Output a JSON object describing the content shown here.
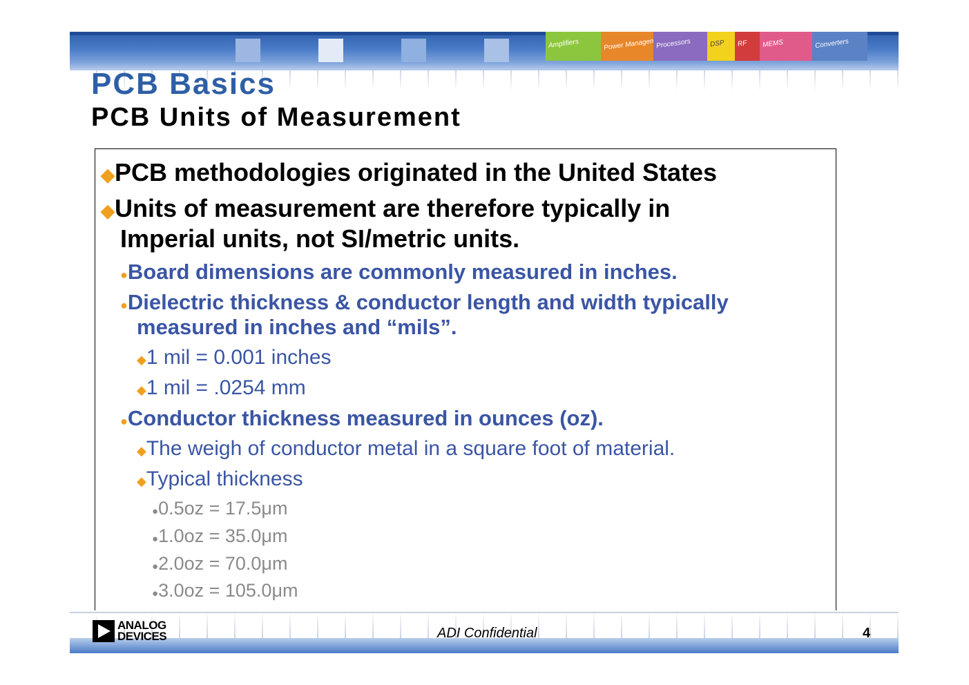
{
  "header": {
    "title": "PCB Basics",
    "subtitle": "PCB Units of Measurement",
    "categories": [
      {
        "label": "Amplifiers",
        "color": "#8cc63f"
      },
      {
        "label": "Power Management",
        "color": "#e8862a"
      },
      {
        "label": "Processors",
        "color": "#8a6bbf"
      },
      {
        "label": "DSP",
        "color": "#f2d21c"
      },
      {
        "label": "RF",
        "color": "#d23c3c"
      },
      {
        "label": "MEMS",
        "color": "#e05a8a"
      },
      {
        "label": "Converters",
        "color": "#5b82c4"
      }
    ]
  },
  "content": {
    "b1_1": "PCB methodologies originated in the United States",
    "b1_2a": "Units of measurement are therefore typically in",
    "b1_2b": "Imperial units, not SI/metric units.",
    "b2_1": "Board dimensions are commonly measured in inches.",
    "b2_2a": "Dielectric thickness & conductor length and width typically",
    "b2_2b": "measured in inches and “mils”.",
    "b3_1": "1 mil = 0.001 inches",
    "b3_2": "1 mil = .0254 mm",
    "b2_3": "Conductor thickness measured in ounces (oz).",
    "b3_3": "The weigh of conductor metal in a square foot of material.",
    "b3_4": "Typical thickness",
    "b4_1": "0.5oz = 17.5μm",
    "b4_2": "1.0oz = 35.0μm",
    "b4_3": "2.0oz = 70.0μm",
    "b4_4": "3.0oz = 105.0μm"
  },
  "markers": {
    "diamond": "◆",
    "dot": "●"
  },
  "footer": {
    "logo_line1": "ANALOG",
    "logo_line2": "DEVICES",
    "confidential": "ADI Confidential",
    "page": "4"
  },
  "colors": {
    "title_blue": "#2e5fa6",
    "body_blue": "#3a55a4",
    "accent_orange": "#f0a020",
    "grey": "#8a8a8a"
  }
}
